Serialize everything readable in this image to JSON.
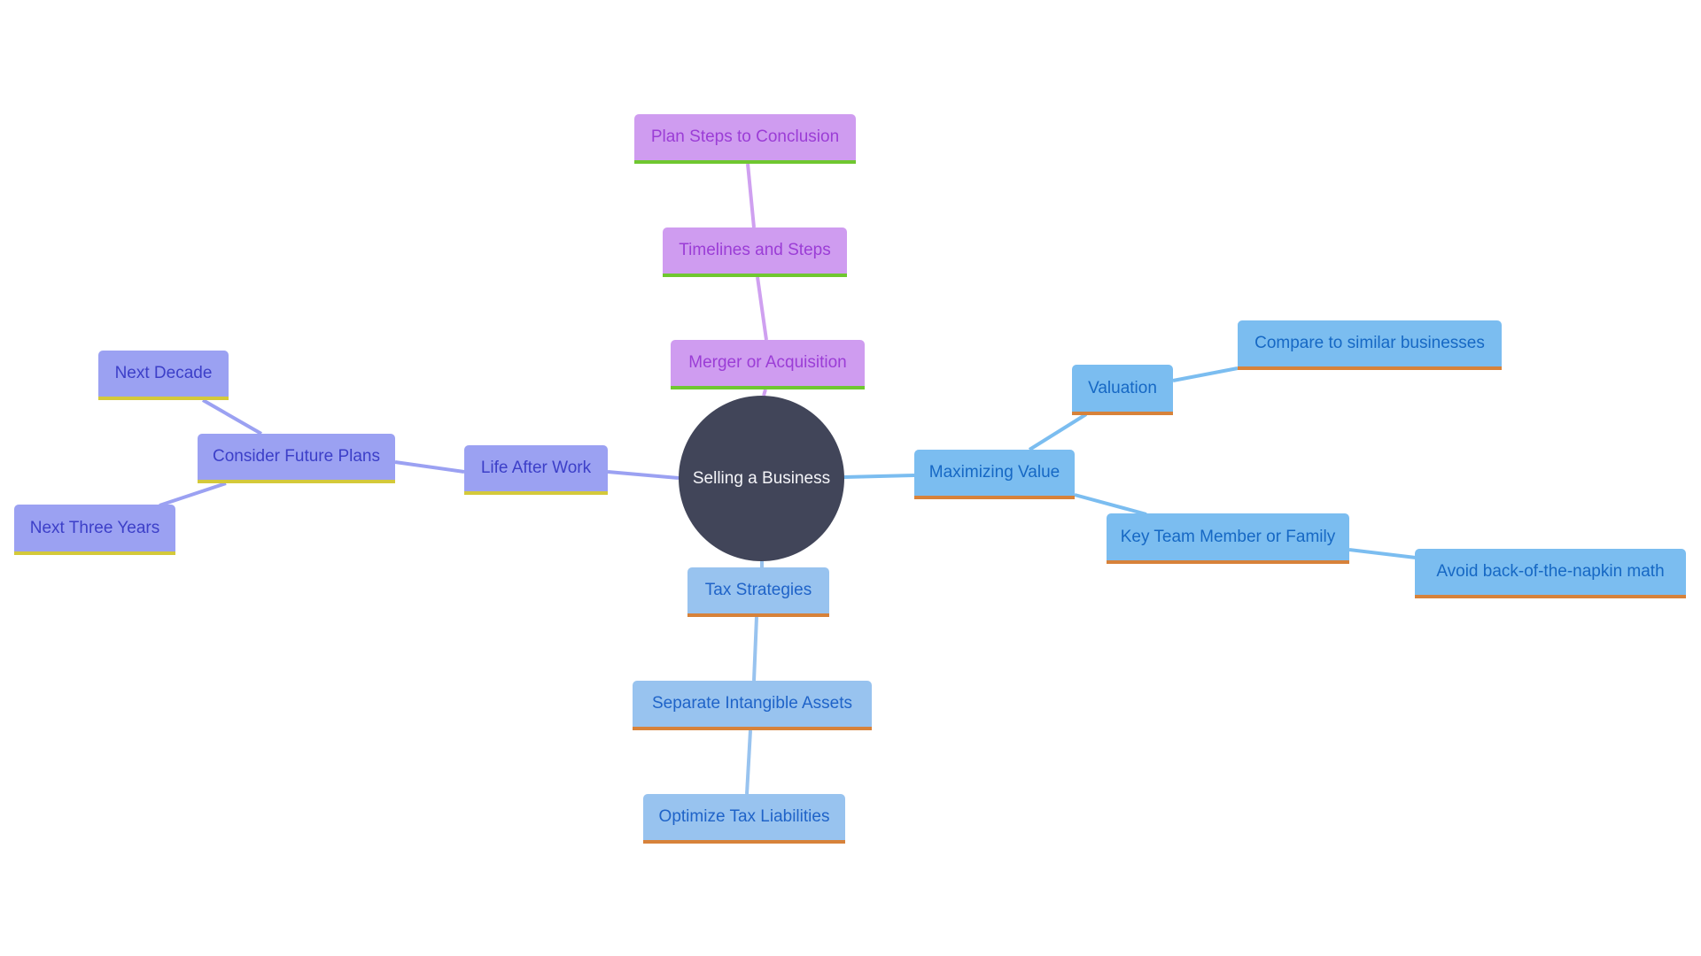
{
  "diagram": {
    "type": "mindmap",
    "root": {
      "id": "root",
      "label": "Selling a Business",
      "color": "#414559",
      "text_color": "#f4f4f8"
    },
    "themes": {
      "purple": {
        "fill": "#cf9cf0",
        "text": "#9b3dd6",
        "stripe": "#6fc730",
        "edge": "#cfa0f0"
      },
      "indigo": {
        "fill": "#9ba1f2",
        "text": "#3c3fc8",
        "stripe": "#d4c93a",
        "edge": "#9ba1f2"
      },
      "sky": {
        "fill": "#7bbdf0",
        "text": "#1668c4",
        "stripe": "#d7823a",
        "edge": "#7bbdf0"
      },
      "tax": {
        "fill": "#98c3ef",
        "text": "#1f63c8",
        "stripe": "#d7823a",
        "edge": "#98c3ef"
      }
    },
    "nodes": [
      {
        "id": "merger",
        "label": "Merger or Acquisition",
        "parent": "root",
        "theme": "purple"
      },
      {
        "id": "timelines",
        "label": "Timelines and Steps",
        "parent": "merger",
        "theme": "purple"
      },
      {
        "id": "plan",
        "label": "Plan Steps to Conclusion",
        "parent": "timelines",
        "theme": "purple"
      },
      {
        "id": "life",
        "label": "Life After Work",
        "parent": "root",
        "theme": "indigo"
      },
      {
        "id": "future",
        "label": "Consider Future Plans",
        "parent": "life",
        "theme": "indigo"
      },
      {
        "id": "decade",
        "label": "Next Decade",
        "parent": "future",
        "theme": "indigo"
      },
      {
        "id": "three",
        "label": "Next Three Years",
        "parent": "future",
        "theme": "indigo"
      },
      {
        "id": "maximizing",
        "label": "Maximizing Value",
        "parent": "root",
        "theme": "sky"
      },
      {
        "id": "valuation",
        "label": "Valuation",
        "parent": "maximizing",
        "theme": "sky"
      },
      {
        "id": "compare",
        "label": "Compare to similar businesses",
        "parent": "valuation",
        "theme": "sky"
      },
      {
        "id": "keyteam",
        "label": "Key Team Member or Family",
        "parent": "maximizing",
        "theme": "sky"
      },
      {
        "id": "napkin",
        "label": "Avoid back-of-the-napkin math",
        "parent": "keyteam",
        "theme": "sky"
      },
      {
        "id": "tax",
        "label": "Tax Strategies",
        "parent": "root",
        "theme": "tax"
      },
      {
        "id": "intangible",
        "label": "Separate Intangible Assets",
        "parent": "tax",
        "theme": "tax"
      },
      {
        "id": "optimize",
        "label": "Optimize Tax Liabilities",
        "parent": "intangible",
        "theme": "tax"
      }
    ]
  }
}
